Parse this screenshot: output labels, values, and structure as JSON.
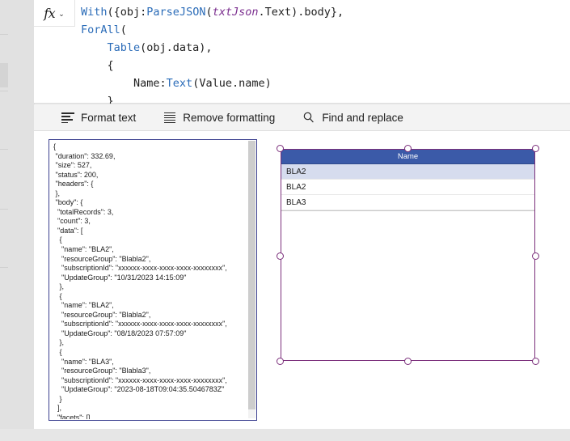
{
  "formula_bar": {
    "fx_label": "fx",
    "chevron": "⌄",
    "code_lines": [
      [
        {
          "t": "With",
          "c": "tok-fn"
        },
        {
          "t": "({obj:",
          "c": "tok-plain"
        },
        {
          "t": "ParseJSON",
          "c": "tok-fn"
        },
        {
          "t": "(",
          "c": "tok-plain"
        },
        {
          "t": "txtJson",
          "c": "tok-ctrl-name"
        },
        {
          "t": ".Text).body},",
          "c": "tok-plain"
        }
      ],
      [
        {
          "t": "ForAll",
          "c": "tok-ctl"
        },
        {
          "t": "(",
          "c": "tok-plain"
        }
      ],
      [
        {
          "t": "    ",
          "c": "tok-plain"
        },
        {
          "t": "Table",
          "c": "tok-fn"
        },
        {
          "t": "(obj.data),",
          "c": "tok-plain"
        }
      ],
      [
        {
          "t": "    {",
          "c": "tok-plain"
        }
      ],
      [
        {
          "t": "        Name:",
          "c": "tok-plain"
        },
        {
          "t": "Text",
          "c": "tok-fn"
        },
        {
          "t": "(Value.name)",
          "c": "tok-plain"
        }
      ],
      [
        {
          "t": "    }",
          "c": "tok-plain"
        }
      ]
    ],
    "full_formula": "With({obj:ParseJSON(txtJson.Text).body},\nForAll(\n    Table(obj.data),\n    {\n        Name:Text(Value.name)\n    }"
  },
  "format_toolbar": {
    "format_text_label": "Format text",
    "remove_formatting_label": "Remove formatting",
    "find_replace_label": "Find and replace"
  },
  "json_textbox": {
    "value": "{\n \"duration\": 332.69,\n \"size\": 527,\n \"status\": 200,\n \"headers\": {\n },\n \"body\": {\n  \"totalRecords\": 3,\n  \"count\": 3,\n  \"data\": [\n   {\n    \"name\": \"BLA2\",\n    \"resourceGroup\": \"Blabla2\",\n    \"subscriptionId\": \"xxxxxx-xxxx-xxxx-xxxx-xxxxxxxx\",\n    \"UpdateGroup\": \"10/31/2023 14:15:09\"\n   },\n   {\n    \"name\": \"BLA2\",\n    \"resourceGroup\": \"Blabla2\",\n    \"subscriptionId\": \"xxxxxx-xxxx-xxxx-xxxx-xxxxxxxx\",\n    \"UpdateGroup\": \"08/18/2023 07:57:09\"\n   },\n   {\n    \"name\": \"BLA3\",\n    \"resourceGroup\": \"Blabla3\",\n    \"subscriptionId\": \"xxxxxx-xxxx-xxxx-xxxx-xxxxxxxx\",\n    \"UpdateGroup\": \"2023-08-18T09:04:35.5046783Z\"\n   }\n  ],\n  \"facets\": [],\n  \"resultTruncated\": false\n },\n \"responseType\": \"json\""
  },
  "data_table": {
    "columns": [
      "Name"
    ],
    "rows": [
      {
        "Name": "BLA2",
        "selected": true
      },
      {
        "Name": "BLA2",
        "selected": false
      },
      {
        "Name": "BLA3",
        "selected": false
      }
    ],
    "header_color": "#3b5aa8",
    "selection_color": "#7b2f7b",
    "selected_row_color": "#d6dcee"
  }
}
